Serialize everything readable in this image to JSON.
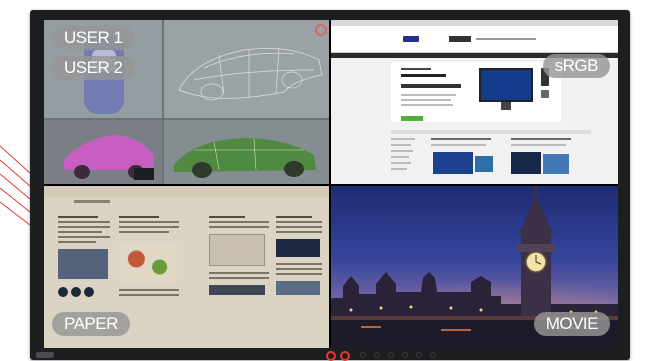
{
  "modes": {
    "user1": "USER 1",
    "user2": "USER 2",
    "srgb": "sRGB",
    "paper": "PAPER",
    "movie": "MOVIE"
  },
  "colors": {
    "accent_ring": "#e8382e",
    "pill_bg": "#969696",
    "bezel": "#1d1e20"
  },
  "icons": {
    "brand": "brand-logo-icon",
    "highlight": "highlighted-button-ring-icon"
  }
}
